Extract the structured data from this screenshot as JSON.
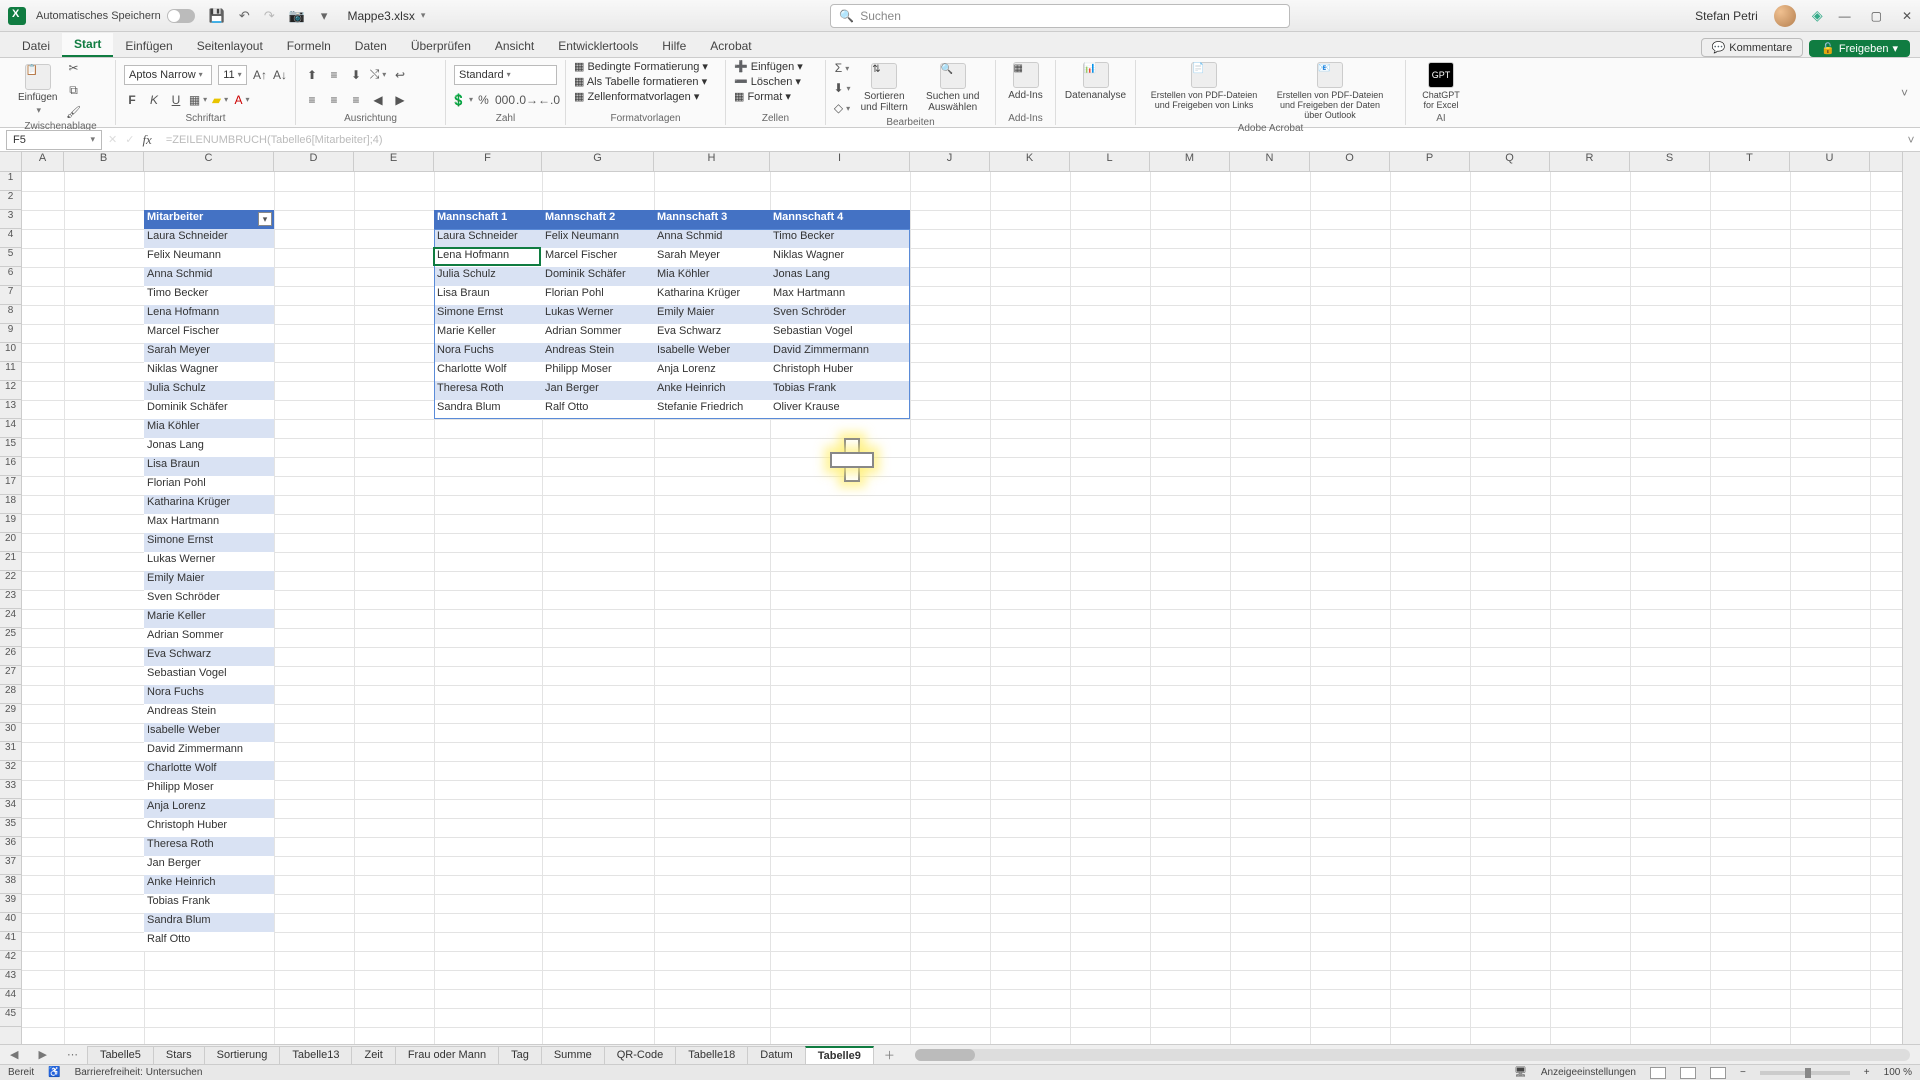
{
  "titlebar": {
    "autosave_label": "Automatisches Speichern",
    "doc_name": "Mappe3.xlsx",
    "search_placeholder": "Suchen",
    "user_name": "Stefan Petri"
  },
  "menu": {
    "tabs": [
      "Datei",
      "Start",
      "Einfügen",
      "Seitenlayout",
      "Formeln",
      "Daten",
      "Überprüfen",
      "Ansicht",
      "Entwicklertools",
      "Hilfe",
      "Acrobat"
    ],
    "active_index": 1,
    "comments": "Kommentare",
    "share": "Freigeben"
  },
  "ribbon": {
    "clipboard": {
      "paste": "Einfügen",
      "label": "Zwischenablage"
    },
    "font": {
      "name": "Aptos Narrow",
      "size": "11",
      "label": "Schriftart"
    },
    "align": {
      "label": "Ausrichtung"
    },
    "number": {
      "format": "Standard",
      "label": "Zahl"
    },
    "styles": {
      "cond": "Bedingte Formatierung",
      "table": "Als Tabelle formatieren",
      "cell": "Zellenformatvorlagen",
      "label": "Formatvorlagen"
    },
    "cells": {
      "insert": "Einfügen",
      "delete": "Löschen",
      "format": "Format",
      "label": "Zellen"
    },
    "editing": {
      "sort": "Sortieren und Filtern",
      "find": "Suchen und Auswählen",
      "label": "Bearbeiten"
    },
    "addins": {
      "addins": "Add-Ins",
      "label": "Add-Ins"
    },
    "analysis": {
      "label": "Datenanalyse"
    },
    "acrobat": {
      "create": "Erstellen von PDF-Dateien und Freigeben von Links",
      "share": "Erstellen von PDF-Dateien und Freigeben der Daten über Outlook",
      "label": "Adobe Acrobat"
    },
    "ai": {
      "gpt": "ChatGPT for Excel",
      "label": "AI"
    }
  },
  "formula": {
    "namebox": "F5",
    "formula": "=ZEILENUMBRUCH(Tabelle6[Mitarbeiter];4)"
  },
  "columns": {
    "letters": [
      "A",
      "B",
      "C",
      "D",
      "E",
      "F",
      "G",
      "H",
      "I",
      "J",
      "K",
      "L",
      "M",
      "N",
      "O",
      "P",
      "Q",
      "R",
      "S",
      "T",
      "U"
    ],
    "widths": [
      42,
      80,
      130,
      80,
      80,
      108,
      112,
      116,
      140,
      80,
      80,
      80,
      80,
      80,
      80,
      80,
      80,
      80,
      80,
      80,
      80
    ]
  },
  "sheetdata": {
    "mitarbeiter_header": "Mitarbeiter",
    "mitarbeiter": [
      "Laura Schneider",
      "Felix Neumann",
      "Anna Schmid",
      "Timo Becker",
      "Lena Hofmann",
      "Marcel Fischer",
      "Sarah Meyer",
      "Niklas Wagner",
      "Julia Schulz",
      "Dominik Schäfer",
      "Mia Köhler",
      "Jonas Lang",
      "Lisa Braun",
      "Florian Pohl",
      "Katharina Krüger",
      "Max Hartmann",
      "Simone Ernst",
      "Lukas Werner",
      "Emily Maier",
      "Sven Schröder",
      "Marie Keller",
      "Adrian Sommer",
      "Eva Schwarz",
      "Sebastian Vogel",
      "Nora Fuchs",
      "Andreas Stein",
      "Isabelle Weber",
      "David Zimmermann",
      "Charlotte Wolf",
      "Philipp Moser",
      "Anja Lorenz",
      "Christoph Huber",
      "Theresa Roth",
      "Jan Berger",
      "Anke Heinrich",
      "Tobias Frank",
      "Sandra Blum",
      "Ralf Otto"
    ],
    "teams_headers": [
      "Mannschaft 1",
      "Mannschaft 2",
      "Mannschaft 3",
      "Mannschaft 4"
    ],
    "teams": [
      [
        "Laura Schneider",
        "Felix Neumann",
        "Anna Schmid",
        "Timo Becker"
      ],
      [
        "Lena Hofmann",
        "Marcel Fischer",
        "Sarah Meyer",
        "Niklas Wagner"
      ],
      [
        "Julia Schulz",
        "Dominik Schäfer",
        "Mia Köhler",
        "Jonas Lang"
      ],
      [
        "Lisa Braun",
        "Florian Pohl",
        "Katharina Krüger",
        "Max Hartmann"
      ],
      [
        "Simone Ernst",
        "Lukas Werner",
        "Emily Maier",
        "Sven Schröder"
      ],
      [
        "Marie Keller",
        "Adrian Sommer",
        "Eva Schwarz",
        "Sebastian Vogel"
      ],
      [
        "Nora Fuchs",
        "Andreas Stein",
        "Isabelle Weber",
        "David Zimmermann"
      ],
      [
        "Charlotte Wolf",
        "Philipp Moser",
        "Anja Lorenz",
        "Christoph Huber"
      ],
      [
        "Theresa Roth",
        "Jan Berger",
        "Anke Heinrich",
        "Tobias Frank"
      ],
      [
        "Sandra Blum",
        "Ralf Otto",
        "Stefanie Friedrich",
        "Oliver Krause"
      ]
    ]
  },
  "sheettabs": {
    "tabs": [
      "Tabelle5",
      "Stars",
      "Sortierung",
      "Tabelle13",
      "Zeit",
      "Frau oder Mann",
      "Tag",
      "Summe",
      "QR-Code",
      "Tabelle18",
      "Datum",
      "Tabelle9"
    ],
    "active_index": 11
  },
  "status": {
    "ready": "Bereit",
    "access": "Barrierefreiheit: Untersuchen",
    "display": "Anzeigeeinstellungen",
    "zoom": "100 %"
  }
}
